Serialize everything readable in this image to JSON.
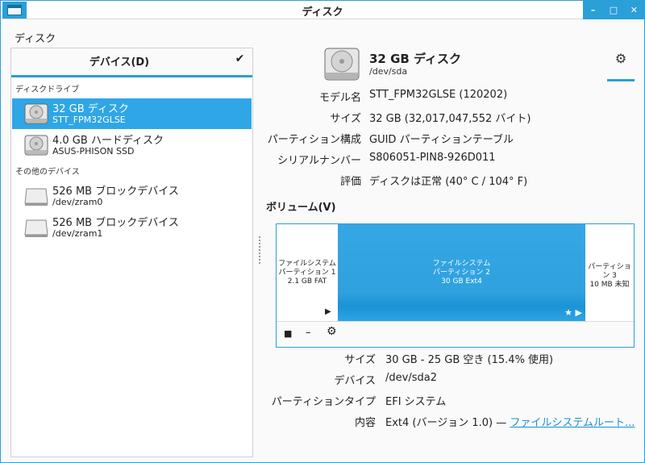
{
  "window": {
    "title": "ディスク",
    "controls": [
      "–",
      "□",
      "✕"
    ],
    "accent": "#2a9fd8"
  },
  "left": {
    "header": "ディスク",
    "tabs": {
      "devices": "デバイス(D)",
      "check": "✔"
    },
    "sections": {
      "drives": "ディスクドライブ",
      "other": "その他のデバイス"
    },
    "drives": [
      {
        "title": "32 GB ディスク",
        "subtitle": "STT_FPM32GLSE",
        "selected": true,
        "icon": "hard-disk-icon"
      },
      {
        "title": "4.0 GB ハードディスク",
        "subtitle": "ASUS-PHISON SSD",
        "selected": false,
        "icon": "hard-disk-icon"
      }
    ],
    "other_devices": [
      {
        "title": "526 MB ブロックデバイス",
        "subtitle": "/dev/zram0",
        "icon": "block-device-icon"
      },
      {
        "title": "526 MB ブロックデバイス",
        "subtitle": "/dev/zram1",
        "icon": "block-device-icon"
      }
    ]
  },
  "disk": {
    "title": "32 GB ディスク",
    "path": "/dev/sda",
    "gear": "⚙",
    "props": [
      {
        "label": "モデル名",
        "value": "STT_FPM32GLSE (120202)"
      },
      {
        "label": "サイズ",
        "value": "32 GB (32,017,047,552 バイト)"
      },
      {
        "label": "パーティション構成",
        "value": "GUID パーティションテーブル"
      },
      {
        "label": "シリアルナンバー",
        "value": "S806051-PIN8-926D011"
      },
      {
        "label": "評価",
        "value": "ディスクは正常 (40° C / 104° F)"
      }
    ]
  },
  "volumes": {
    "title": "ボリューム(V)",
    "partitions": [
      {
        "line1": "ファイルシステム",
        "line2": "パーティション 1",
        "line3": "2.1 GB FAT"
      },
      {
        "line1": "ファイルシステム",
        "line2": "パーティション 2",
        "line3": "30 GB Ext4"
      },
      {
        "line1": "パーティション 3",
        "line2": "10 MB 未知"
      }
    ],
    "toolbar": {
      "stop": "■",
      "remove": "–",
      "settings": "⚙"
    },
    "details": [
      {
        "label": "サイズ",
        "value": "30 GB - 25 GB 空き (15.4% 使用)"
      },
      {
        "label": "デバイス",
        "value": "/dev/sda2"
      },
      {
        "label": "パーティションタイプ",
        "value": "EFI システム"
      },
      {
        "label": "内容",
        "value": "Ext4 (バージョン 1.0) — ",
        "link": "ファイルシステムルート..."
      }
    ]
  }
}
